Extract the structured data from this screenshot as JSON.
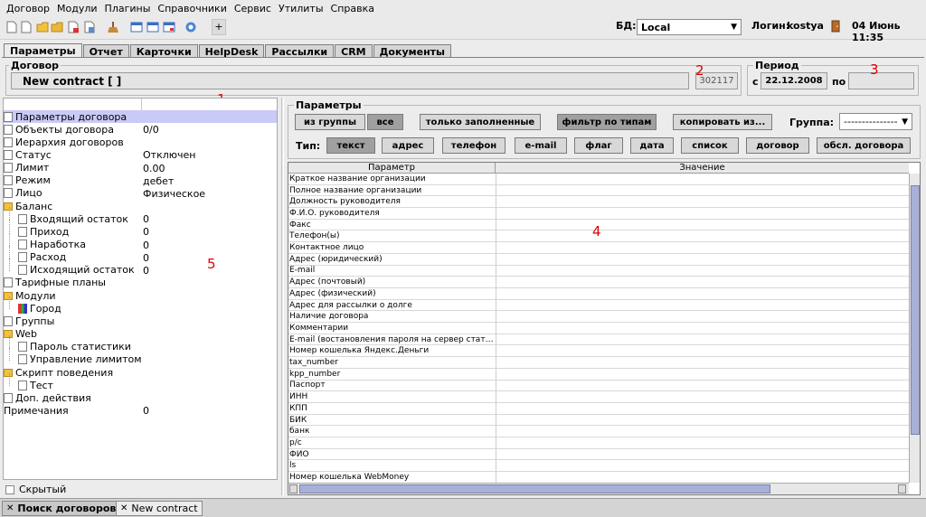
{
  "menu": [
    "Договор",
    "Модули",
    "Плагины",
    "Справочники",
    "Сервис",
    "Утилиты",
    "Справка"
  ],
  "toolbar": {
    "plus": "+",
    "db_label": "БД:",
    "db_value": "Local",
    "login_label": "Логин:",
    "login_value": "kostya",
    "datetime": "04 Июнь 11:35"
  },
  "tabs": [
    "Параметры",
    "Отчет",
    "Карточки",
    "HelpDesk",
    "Рассылки",
    "CRM",
    "Документы"
  ],
  "contract": {
    "group_title": "Договор",
    "name": "New contract [  ]",
    "id": "302117"
  },
  "period": {
    "group_title": "Период",
    "from_label": "с",
    "from": "22.12.2008",
    "to_label": "по",
    "to": ""
  },
  "markers": [
    "1",
    "2",
    "3",
    "4",
    "5"
  ],
  "tree": {
    "rows": [
      {
        "label": "Параметры договора",
        "value": "",
        "icon": "doc"
      },
      {
        "label": "Объекты договора",
        "value": "0/0",
        "icon": "doc"
      },
      {
        "label": "Иерархия договоров",
        "value": "",
        "icon": "doc"
      },
      {
        "label": "Статус",
        "value": "Отключен",
        "icon": "doc"
      },
      {
        "label": "Лимит",
        "value": "0.00",
        "icon": "doc"
      },
      {
        "label": "Режим",
        "value": "дебет",
        "icon": "doc"
      },
      {
        "label": "Лицо",
        "value": "Физическое",
        "icon": "doc"
      },
      {
        "label": "Баланс",
        "value": "",
        "icon": "folder"
      },
      {
        "label": "Входящий остаток",
        "value": "0",
        "icon": "doc"
      },
      {
        "label": "Приход",
        "value": "0",
        "icon": "doc"
      },
      {
        "label": "Наработка",
        "value": "0",
        "icon": "doc"
      },
      {
        "label": "Расход",
        "value": "0",
        "icon": "doc"
      },
      {
        "label": "Исходящий остаток",
        "value": "0",
        "icon": "doc"
      },
      {
        "label": "Тарифные планы",
        "value": "",
        "icon": "doc"
      },
      {
        "label": "Модули",
        "value": "",
        "icon": "folder-module"
      },
      {
        "label": "Город",
        "value": "",
        "icon": "module"
      },
      {
        "label": "Группы",
        "value": "",
        "icon": "doc"
      },
      {
        "label": "Web",
        "value": "",
        "icon": "folder"
      },
      {
        "label": "Пароль статистики",
        "value": "",
        "icon": "doc"
      },
      {
        "label": "Управление лимитом",
        "value": "",
        "icon": "doc"
      },
      {
        "label": "Скрипт поведения",
        "value": "",
        "icon": "folder"
      },
      {
        "label": "Тест",
        "value": "",
        "icon": "doc"
      },
      {
        "label": "Доп. действия",
        "value": "",
        "icon": "doc"
      },
      {
        "label": "Примечания",
        "value": "0",
        "icon": "none"
      }
    ],
    "hidden_label": "Скрытый"
  },
  "params": {
    "group_title": "Параметры",
    "btn_from_group": "из группы",
    "btn_all": "все",
    "btn_filled": "только заполненные",
    "btn_filter": "фильтр по типам",
    "btn_copy": "копировать из...",
    "group_label": "Группа:",
    "group_value": "---------------",
    "type_label": "Тип:",
    "types": [
      "текст",
      "адрес",
      "телефон",
      "e-mail",
      "флаг",
      "дата",
      "список",
      "договор",
      "обсл. договора"
    ]
  },
  "grid": {
    "col_param": "Параметр",
    "col_value": "Значение",
    "rows": [
      "Краткое название организации",
      "Полное название организации",
      "Должность руководителя",
      "Ф.И.О. руководителя",
      "Факс",
      "Телефон(ы)",
      "Контактное лицо",
      "Адрес (юридический)",
      "E-mail",
      "Адрес (почтовый)",
      "Адрес (физический)",
      "Адрес для рассылки о долге",
      "Наличие договора",
      "Комментарии",
      "E-mail (востановления пароля на сервер стат…",
      "Номер кошелька Яндекс.Деньги",
      "tax_number",
      "kpp_number",
      "Паспорт",
      "ИНН",
      "КПП",
      "БИК",
      "банк",
      "р/с",
      "ФИО",
      "ls",
      "Номер кошелька WebMoney"
    ]
  },
  "bottom_tabs": [
    "Поиск договоров",
    "New contract"
  ],
  "close_glyph": "✕"
}
